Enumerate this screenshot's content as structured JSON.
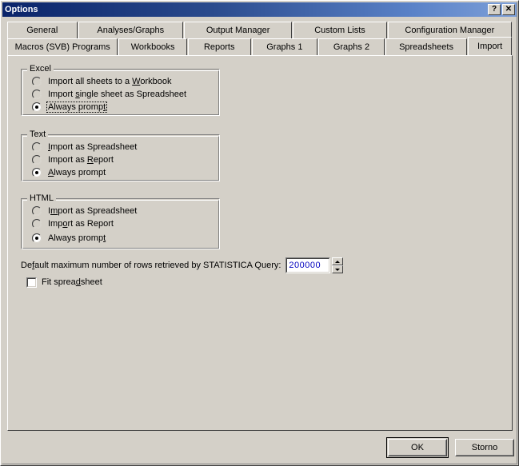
{
  "window": {
    "title": "Options",
    "help_button": "?",
    "close_button": "✕"
  },
  "tabs": {
    "row1": [
      {
        "label": "General",
        "active": false
      },
      {
        "label": "Analyses/Graphs",
        "active": false
      },
      {
        "label": "Output Manager",
        "active": false
      },
      {
        "label": "Custom Lists",
        "active": false
      },
      {
        "label": "Configuration Manager",
        "active": false
      }
    ],
    "row2": [
      {
        "label": "Macros (SVB) Programs",
        "active": false
      },
      {
        "label": "Workbooks",
        "active": false
      },
      {
        "label": "Reports",
        "active": false
      },
      {
        "label": "Graphs 1",
        "active": false
      },
      {
        "label": "Graphs 2",
        "active": false
      },
      {
        "label": "Spreadsheets",
        "active": false
      },
      {
        "label": "Import",
        "active": true
      }
    ]
  },
  "groups": {
    "excel": {
      "title": "Excel",
      "options": [
        {
          "label": "Import all sheets to a Workbook",
          "accel": "W",
          "selected": false,
          "focused": false
        },
        {
          "label": "Import single sheet as Spreadsheet",
          "accel": "s",
          "selected": false,
          "focused": false
        },
        {
          "label": "Always prompt",
          "accel": "t",
          "selected": true,
          "focused": true
        }
      ]
    },
    "text": {
      "title": "Text",
      "options": [
        {
          "label": "Import as Spreadsheet",
          "accel": "I",
          "selected": false,
          "focused": false
        },
        {
          "label": "Import as Report",
          "accel": "R",
          "selected": false,
          "focused": false
        },
        {
          "label": "Always prompt",
          "accel": "A",
          "selected": true,
          "focused": false
        }
      ]
    },
    "html": {
      "title": "HTML",
      "options": [
        {
          "label": "Import as Spreadsheet",
          "accel": "m",
          "selected": false,
          "focused": false
        },
        {
          "label": "Import as Report",
          "accel": "o",
          "selected": false,
          "focused": false
        },
        {
          "label": "Always prompt",
          "accel": "t",
          "selected": true,
          "focused": false
        }
      ]
    }
  },
  "query": {
    "label": "Default maximum number of rows retrieved by STATISTICA Query:",
    "accel": "f",
    "value": "200000",
    "spin_up_icon": "arrow-up-icon",
    "spin_down_icon": "arrow-down-icon"
  },
  "fit_spreadsheet": {
    "label": "Fit spreadsheet",
    "accel": "d",
    "checked": false
  },
  "buttons": {
    "ok": "OK",
    "cancel": "Storno"
  },
  "colors": {
    "face": "#d4d0c8",
    "title_left": "#0a246a",
    "title_right": "#7ea0d8",
    "field_text": "#0000bf"
  }
}
